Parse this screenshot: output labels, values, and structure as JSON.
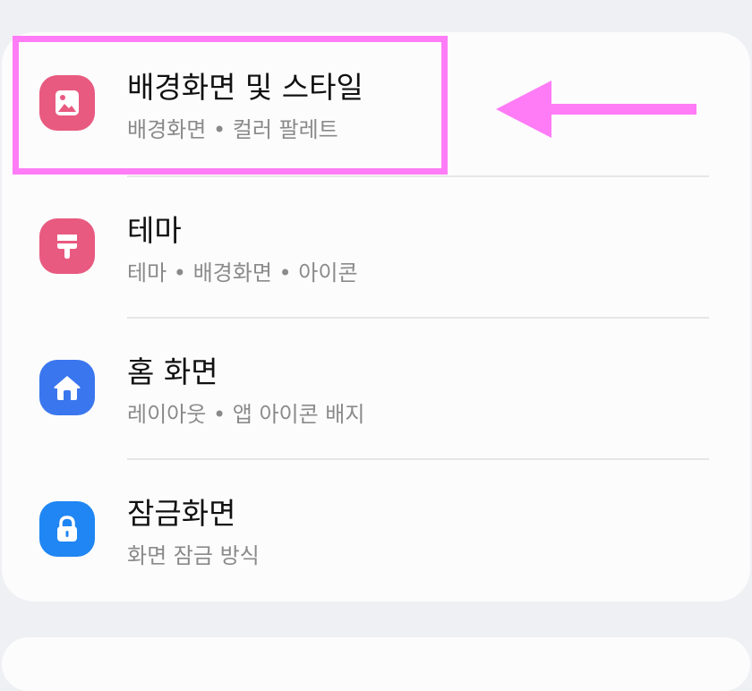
{
  "colors": {
    "page_background": "#eff0f4",
    "card_background": "#fcfcfc",
    "pink_icon": "#e85a80",
    "blue_icon": "#3a76ee",
    "lock_blue_icon": "#1f86f3",
    "annotation_magenta": "#ff7cf6"
  },
  "settings": {
    "items": [
      {
        "title": "배경화면 및 스타일",
        "subtitle": "배경화면 • 컬러 팔레트",
        "icon": "wallpaper-icon"
      },
      {
        "title": "테마",
        "subtitle": "테마 • 배경화면 • 아이콘",
        "icon": "theme-brush-icon"
      },
      {
        "title": "홈 화면",
        "subtitle": "레이아웃 • 앱 아이콘 배지",
        "icon": "home-icon"
      },
      {
        "title": "잠금화면",
        "subtitle": "화면 잠금 방식",
        "icon": "lock-icon"
      }
    ]
  },
  "annotation": {
    "highlight": "highlight-box",
    "pointer": "arrow-left-icon"
  }
}
